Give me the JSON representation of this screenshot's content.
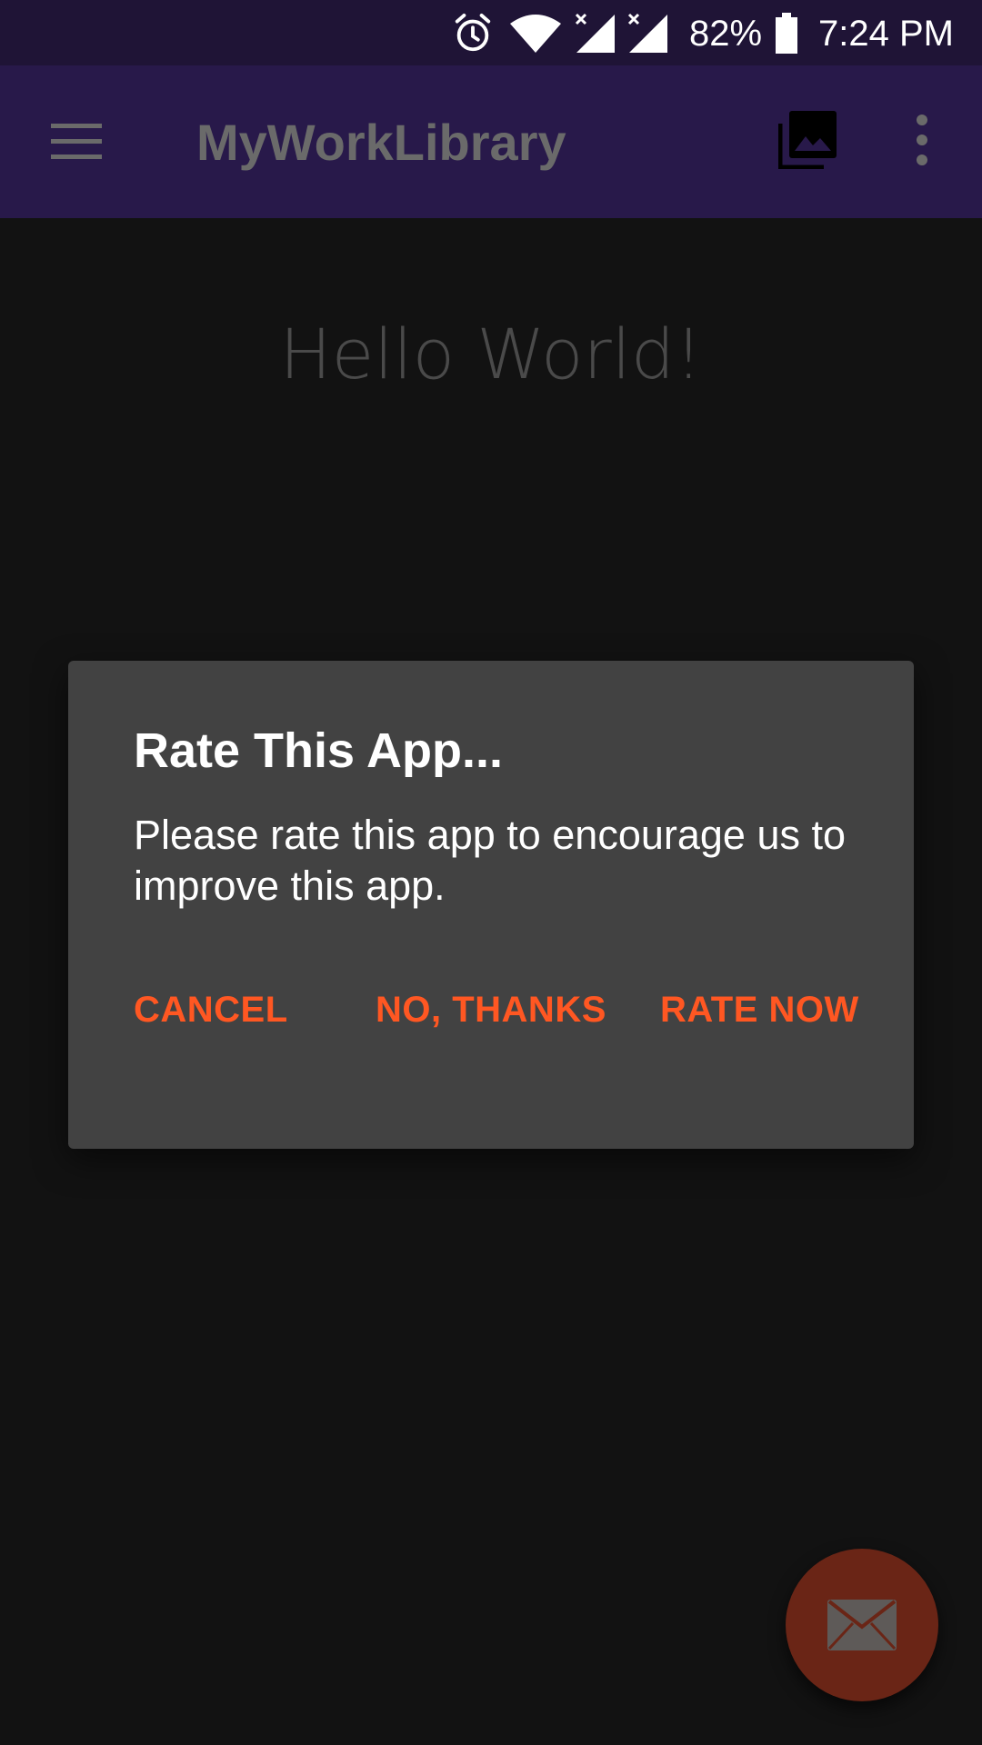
{
  "status_bar": {
    "battery_percent": "82%",
    "time": "7:24 PM",
    "icons": [
      "alarm-icon",
      "wifi-icon",
      "signal-no-service-icon",
      "signal-no-service-icon",
      "battery-icon"
    ]
  },
  "app_bar": {
    "title": "MyWorkLibrary",
    "icons": [
      "menu-icon",
      "photo-library-icon",
      "overflow-menu-icon"
    ]
  },
  "content": {
    "hello": "Hello World!"
  },
  "dialog": {
    "title": "Rate This App...",
    "message": "Please rate this app to encourage us to improve this app.",
    "buttons": {
      "cancel": "CANCEL",
      "no_thanks": "NO, THANKS",
      "rate_now": "RATE NOW"
    }
  },
  "fab": {
    "icon": "mail-icon"
  },
  "colors": {
    "status_bar": "#1f1436",
    "app_bar": "#28194a",
    "background": "#121212",
    "dialog": "#424242",
    "accent": "#ff5722",
    "fab": "#6a2516"
  }
}
